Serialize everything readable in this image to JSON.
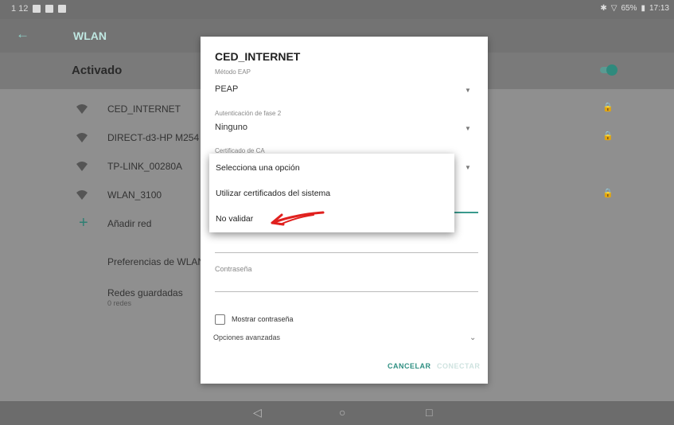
{
  "statusbar": {
    "left_text": "1 12",
    "right_battery": "65%",
    "right_time": "17:13"
  },
  "appbar": {
    "title": "WLAN"
  },
  "activado": {
    "label": "Activado"
  },
  "networks": [
    {
      "name": "CED_INTERNET",
      "locked": true
    },
    {
      "name": "DIRECT-d3-HP M254 Las",
      "locked": true
    },
    {
      "name": "TP-LINK_00280A",
      "locked": false
    },
    {
      "name": "WLAN_3100",
      "locked": true
    }
  ],
  "add_network": "Añadir red",
  "preferences": "Preferencias de WLAN",
  "saved": {
    "title": "Redes guardadas",
    "subtitle": "0 redes"
  },
  "dialog": {
    "title": "CED_INTERNET",
    "eap_label": "Método EAP",
    "eap_value": "PEAP",
    "phase2_label": "Autenticación de fase 2",
    "phase2_value": "Ninguno",
    "ca_label": "Certificado de CA",
    "password_label": "Contraseña",
    "show_password": "Mostrar contraseña",
    "advanced": "Opciones avanzadas",
    "cancel": "CANCELAR",
    "connect": "CONECTAR"
  },
  "dropdown": {
    "options": [
      "Selecciona una opción",
      "Utilizar certificados del sistema",
      "No validar"
    ]
  },
  "colors": {
    "accent": "#2e8f82",
    "annotation": "#e0201e"
  }
}
